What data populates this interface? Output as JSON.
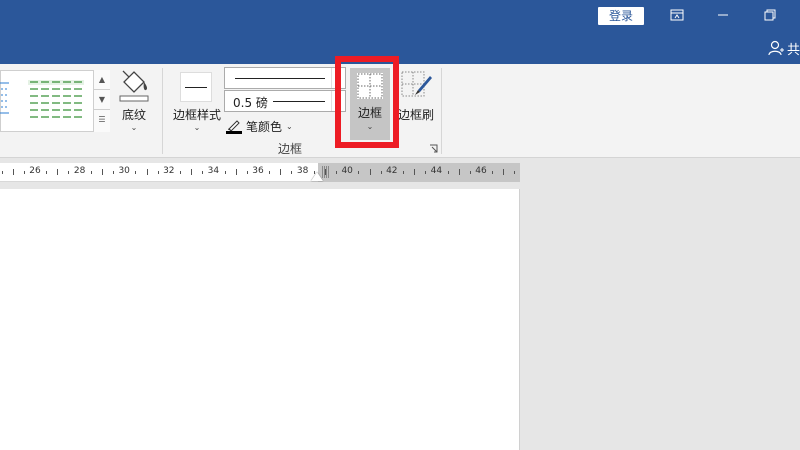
{
  "titlebar": {
    "login_label": "登录",
    "share_label": "共",
    "icons": [
      "ribbon-display-icon",
      "minimize-icon",
      "restore-icon",
      "person-icon"
    ]
  },
  "ribbon": {
    "shading_label": "底纹",
    "border_style_label": "边框样式",
    "line_weight_label": "0.5 磅",
    "pen_color_label": "笔颜色",
    "borders_label": "边框",
    "border_painter_label": "边框刷",
    "group_label": "边框",
    "caret": "⌄",
    "dropdown_arrow": "▾",
    "accent_color": "#ed1c24"
  },
  "ruler": {
    "labels": [
      "26",
      "28",
      "30",
      "32",
      "34",
      "36",
      "38",
      "40",
      "42",
      "44",
      "46"
    ]
  },
  "colors": {
    "title_bar": "#2b579a",
    "ribbon_bg": "#f3f3f3",
    "highlight_border": "#ed1c24",
    "gallery_table_green": "#2e8b2e"
  }
}
